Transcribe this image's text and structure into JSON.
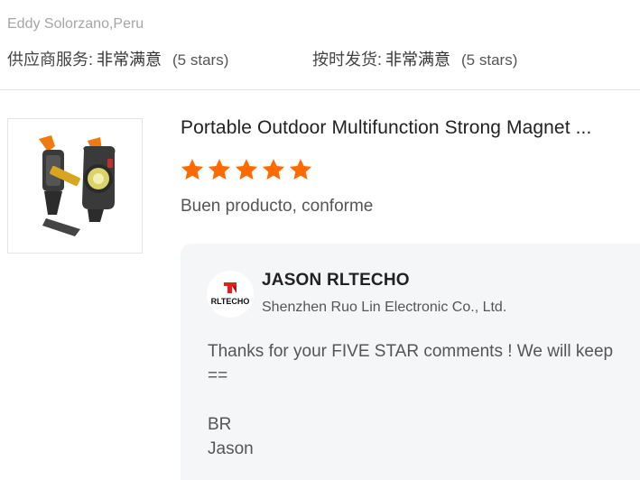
{
  "reviewer": {
    "name": "Eddy Solorzano,Peru"
  },
  "ratings": [
    {
      "label": "供应商服务:",
      "value": "非常满意",
      "stars_text": "(5 stars)"
    },
    {
      "label": "按时发货:",
      "value": "非常满意",
      "stars_text": "(5 stars)"
    }
  ],
  "product": {
    "title": "Portable Outdoor Multifunction Strong Magnet ...",
    "image_icon": "multitool-flashlight-image",
    "rating_stars": 5
  },
  "review": {
    "text": "Buen producto, conforme"
  },
  "reply": {
    "seller_name": "JASON RLTECHO",
    "seller_company": "Shenzhen Ruo Lin Electronic Co., Ltd.",
    "logo_text": "RLTECHO",
    "message": "Thanks for your FIVE STAR comments ! We will keep\n==\n\nBR\nJason"
  },
  "colors": {
    "star": "#ff6a00",
    "logo_red": "#e02020",
    "reply_bg": "#f5f6f8"
  }
}
